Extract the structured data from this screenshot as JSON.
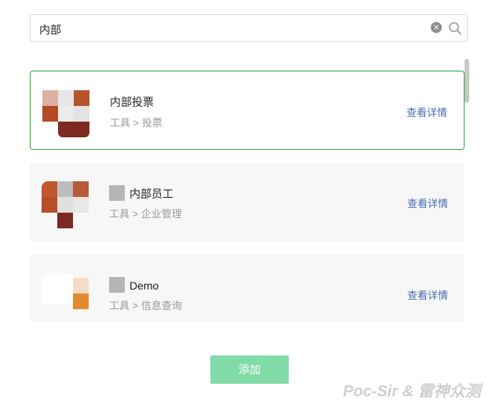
{
  "search": {
    "value": "内部",
    "clear_icon": "clear-circle-icon",
    "search_icon": "magnifier-icon"
  },
  "list": {
    "items": [
      {
        "title": "内部投票",
        "subtitle": "工具 > 投票",
        "detail_link": "查看详情",
        "selected": true
      },
      {
        "title": "内部员工",
        "subtitle": "工具 > 企业管理",
        "detail_link": "查看详情",
        "selected": false
      },
      {
        "title": "Demo",
        "subtitle": "工具 > 信息查询",
        "detail_link": "查看详情",
        "selected": false
      }
    ]
  },
  "add_button": {
    "label": "添加"
  },
  "watermark": {
    "text": "Poc-Sir & 雷神众测"
  },
  "colors": {
    "selected_border": "#2ea63a",
    "link": "#4a6bb0",
    "button": "#80dba9"
  }
}
